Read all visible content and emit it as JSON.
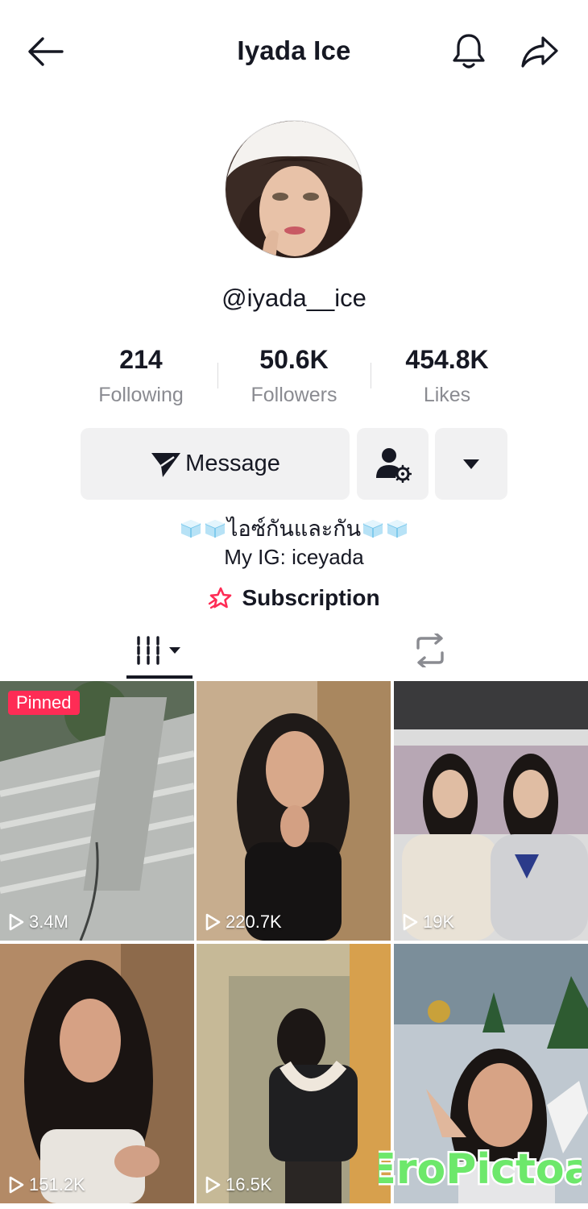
{
  "header": {
    "title": "Iyada Ice"
  },
  "profile": {
    "handle": "@iyada__ice",
    "stats": [
      {
        "value": "214",
        "label": "Following"
      },
      {
        "value": "50.6K",
        "label": "Followers"
      },
      {
        "value": "454.8K",
        "label": "Likes"
      }
    ],
    "message_label": "Message",
    "bio_text": "ไอซ์กันและกัน",
    "bio_ig": "My IG: iceyada",
    "subscription_label": "Subscription"
  },
  "videos": [
    {
      "views": "3.4M",
      "pinned_label": "Pinned"
    },
    {
      "views": "220.7K"
    },
    {
      "views": "19K"
    },
    {
      "views": "151.2K"
    },
    {
      "views": "16.5K"
    },
    {
      "views": ""
    }
  ],
  "watermark": "EroPictoa",
  "icons": {
    "back": "arrow-left-icon",
    "bell": "bell-icon",
    "share": "share-arrow-icon",
    "message": "send-icon",
    "friend": "person-settings-icon",
    "more": "caret-down-icon",
    "subscription": "star-icon",
    "videos_tab": "grid-icon",
    "repost_tab": "repost-icon",
    "play": "play-icon",
    "ice": "ice-cube-icon"
  },
  "colors": {
    "accent": "#fe2c55",
    "text": "#161823",
    "muted": "#8a8b91",
    "button_bg": "#f1f1f2"
  }
}
